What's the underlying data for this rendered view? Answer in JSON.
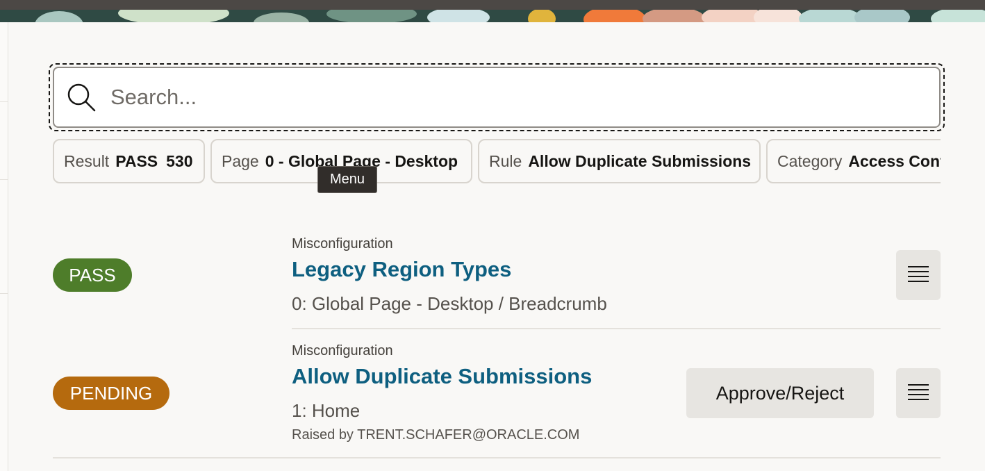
{
  "search": {
    "placeholder": "Search..."
  },
  "filters": [
    {
      "key": "Result",
      "value": "PASS",
      "count": "530"
    },
    {
      "key": "Page",
      "value": "0 - Global Page - Desktop"
    },
    {
      "key": "Rule",
      "value": "Allow Duplicate Submissions"
    },
    {
      "key": "Category",
      "value": "Access Control"
    }
  ],
  "tooltip": "Menu",
  "results": [
    {
      "status": "PASS",
      "status_color": "#4e7d2a",
      "category": "Misconfiguration",
      "title": "Legacy Region Types",
      "location": "0: Global Page - Desktop / Breadcrumb"
    },
    {
      "status": "PENDING",
      "status_color": "#b56a0e",
      "category": "Misconfiguration",
      "title": "Allow Duplicate Submissions",
      "location": "1: Home",
      "raised_by": "Raised by TRENT.SCHAFER@ORACLE.COM",
      "action_label": "Approve/Reject"
    }
  ],
  "icons": {
    "search": "search-icon",
    "menu": "hamburger-menu-icon"
  },
  "colors": {
    "link": "#0e5f80",
    "pass": "#4e7d2a",
    "pending": "#b56a0e"
  }
}
